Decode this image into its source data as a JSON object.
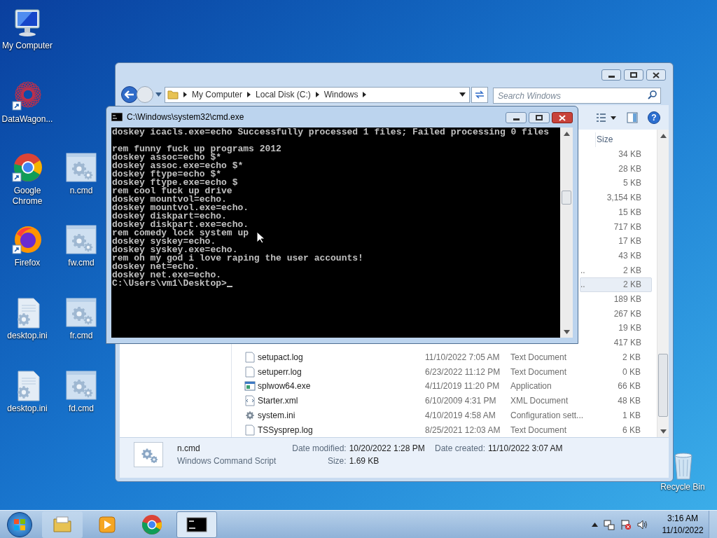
{
  "desktop_icons": [
    {
      "label": "My Computer",
      "kind": "computer"
    },
    {
      "label": "DataWagon...",
      "kind": "shortcut-art"
    },
    {
      "label": "Google Chrome",
      "kind": "chrome"
    },
    {
      "label": "n.cmd",
      "kind": "cmd"
    },
    {
      "label": "Firefox",
      "kind": "firefox"
    },
    {
      "label": "fw.cmd",
      "kind": "cmd"
    },
    {
      "label": "desktop.ini",
      "kind": "ini"
    },
    {
      "label": "fr.cmd",
      "kind": "cmd"
    },
    {
      "label": "desktop.ini",
      "kind": "ini"
    },
    {
      "label": "fd.cmd",
      "kind": "cmd"
    },
    {
      "label": "Recycle Bin",
      "kind": "recycle"
    }
  ],
  "explorer": {
    "breadcrumb": [
      "My Computer",
      "Local Disk (C:)",
      "Windows"
    ],
    "search": {
      "placeholder": "Search Windows"
    },
    "help_button": "?",
    "columns": [
      "Size"
    ],
    "rows": [
      {
        "size": "34 KB",
        "selected": false
      },
      {
        "size": "28 KB",
        "selected": false
      },
      {
        "size": "5 KB",
        "selected": false
      },
      {
        "size": "3,154 KB",
        "selected": false
      },
      {
        "size": "15 KB",
        "selected": false
      },
      {
        "size": "717 KB",
        "selected": false
      },
      {
        "size": "17 KB",
        "selected": false
      },
      {
        "size": "43 KB",
        "selected": false
      },
      {
        "type_tail": "..",
        "size": "2 KB",
        "selected": false
      },
      {
        "type_tail": "..",
        "size": "2 KB",
        "selected": true
      },
      {
        "size": "189 KB",
        "selected": false
      },
      {
        "size": "267 KB",
        "selected": false
      },
      {
        "size": "19 KB",
        "selected": false
      },
      {
        "size": "417 KB",
        "selected": false
      },
      {
        "name": "setupact.log",
        "date": "11/10/2022 7:05 AM",
        "type": "Text Document",
        "size": "2 KB",
        "kind": "text",
        "selected": false
      },
      {
        "name": "setuperr.log",
        "date": "6/23/2022 11:12 PM",
        "type": "Text Document",
        "size": "0 KB",
        "kind": "text",
        "selected": false
      },
      {
        "name": "splwow64.exe",
        "date": "4/11/2019 11:20 PM",
        "type": "Application",
        "size": "66 KB",
        "kind": "exe",
        "selected": false
      },
      {
        "name": "Starter.xml",
        "date": "6/10/2009 4:31 PM",
        "type": "XML Document",
        "size": "48 KB",
        "kind": "xml",
        "selected": false
      },
      {
        "name": "system.ini",
        "date": "4/10/2019 4:58 AM",
        "type": "Configuration sett...",
        "size": "1 KB",
        "kind": "ini",
        "selected": false
      },
      {
        "name": "TSSysprep.log",
        "date": "8/25/2021 12:03 AM",
        "type": "Text Document",
        "size": "6 KB",
        "kind": "text",
        "selected": false
      }
    ],
    "details": {
      "name": "n.cmd",
      "type": "Windows Command Script",
      "modified_label": "Date modified:",
      "modified": "10/20/2022 1:28 PM",
      "created_label": "Date created:",
      "created": "11/10/2022 3:07 AM",
      "size_label": "Size:",
      "size": "1.69 KB"
    }
  },
  "console": {
    "title": "C:\\Windows\\system32\\cmd.exe",
    "first_line": "doskey icacls.exe=echo Successfully processed 1 files; Failed processing 0 files",
    "lines": [
      "rem funny fuck up programs 2012",
      "doskey assoc=echo $*",
      "doskey assoc.exe=echo $*",
      "doskey ftype=echo $*",
      "doskey ftype.exe=echo $",
      "rem cool fuck up drive",
      "doskey mountvol=echo.",
      "doskey mountvol.exe=echo.",
      "doskey diskpart=echo.",
      "doskey diskpart.exe=echo.",
      "rem comedy lock system up",
      "doskey syskey=echo.",
      "doskey syskey.exe=echo.",
      "rem oh my god i love raping the user accounts!",
      "doskey net=echo.",
      "doskey net.exe=echo."
    ],
    "prompt": "C:\\Users\\vm1\\Desktop>"
  },
  "taskbar": {
    "items": [
      {
        "kind": "explorer",
        "selected": false
      },
      {
        "kind": "media",
        "selected": false
      },
      {
        "kind": "chrome",
        "selected": false
      },
      {
        "kind": "cmd",
        "selected": true
      }
    ],
    "time": "3:16 AM",
    "date": "11/10/2022"
  }
}
